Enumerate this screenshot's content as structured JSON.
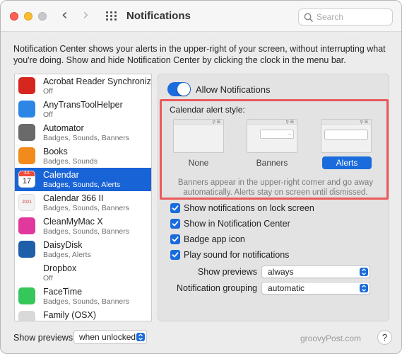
{
  "window": {
    "title": "Notifications",
    "search_placeholder": "Search",
    "description": "Notification Center shows your alerts in the upper-right of your screen, without interrupting what you're doing. Show and hide Notification Center by clicking the clock in the menu bar."
  },
  "apps": [
    {
      "name": "Acrobat Reader Synchroniz…",
      "sub": "Off",
      "icon": "acrobat-icon",
      "color": "#d7261d"
    },
    {
      "name": "AnyTransToolHelper",
      "sub": "Off",
      "icon": "anytrans-icon",
      "color": "#2b86e6"
    },
    {
      "name": "Automator",
      "sub": "Badges, Sounds, Banners",
      "icon": "automator-icon",
      "color": "#6a6a6a"
    },
    {
      "name": "Books",
      "sub": "Badges, Sounds",
      "icon": "books-icon",
      "color": "#f28a1c"
    },
    {
      "name": "Calendar",
      "sub": "Badges, Sounds, Alerts",
      "icon": "calendar-icon",
      "color": "#ffffff",
      "selected": true,
      "day": "17",
      "month": "JUL"
    },
    {
      "name": "Calendar 366 II",
      "sub": "Badges, Sounds, Banners",
      "icon": "calendar-366-icon",
      "color": "#f2f2f2",
      "year": "2021"
    },
    {
      "name": "CleanMyMac X",
      "sub": "Badges, Sounds, Banners",
      "icon": "cleanmymac-icon",
      "color": "#e0389c"
    },
    {
      "name": "DaisyDisk",
      "sub": "Badges, Alerts",
      "icon": "daisydisk-icon",
      "color": "#1d5fa8"
    },
    {
      "name": "Dropbox",
      "sub": "Off",
      "icon": "dropbox-icon",
      "color": "#ffffff"
    },
    {
      "name": "FaceTime",
      "sub": "Badges, Sounds, Banners",
      "icon": "facetime-icon",
      "color": "#35c759"
    },
    {
      "name": "Family (OSX)",
      "sub": "",
      "icon": "family-icon",
      "color": "#d9d9d9"
    }
  ],
  "detail": {
    "allow_notifications": "Allow Notifications",
    "alert_style_label": "Calendar alert style:",
    "styles": [
      "None",
      "Banners",
      "Alerts"
    ],
    "selected_style": "Alerts",
    "explanation": "Banners appear in the upper-right corner and go away automatically. Alerts stay on screen until dismissed.",
    "checkboxes": [
      "Show notifications on lock screen",
      "Show in Notification Center",
      "Badge app icon",
      "Play sound for notifications"
    ],
    "show_previews_label": "Show previews",
    "show_previews_value": "always",
    "grouping_label": "Notification grouping",
    "grouping_value": "automatic"
  },
  "footer": {
    "show_previews_label": "Show previews:",
    "show_previews_value": "when unlocked",
    "watermark": "groovyPost.com",
    "help": "?"
  },
  "colors": {
    "accent": "#1a6bdc",
    "highlight_box": "#ea5a5a",
    "selection": "#1863d6"
  }
}
